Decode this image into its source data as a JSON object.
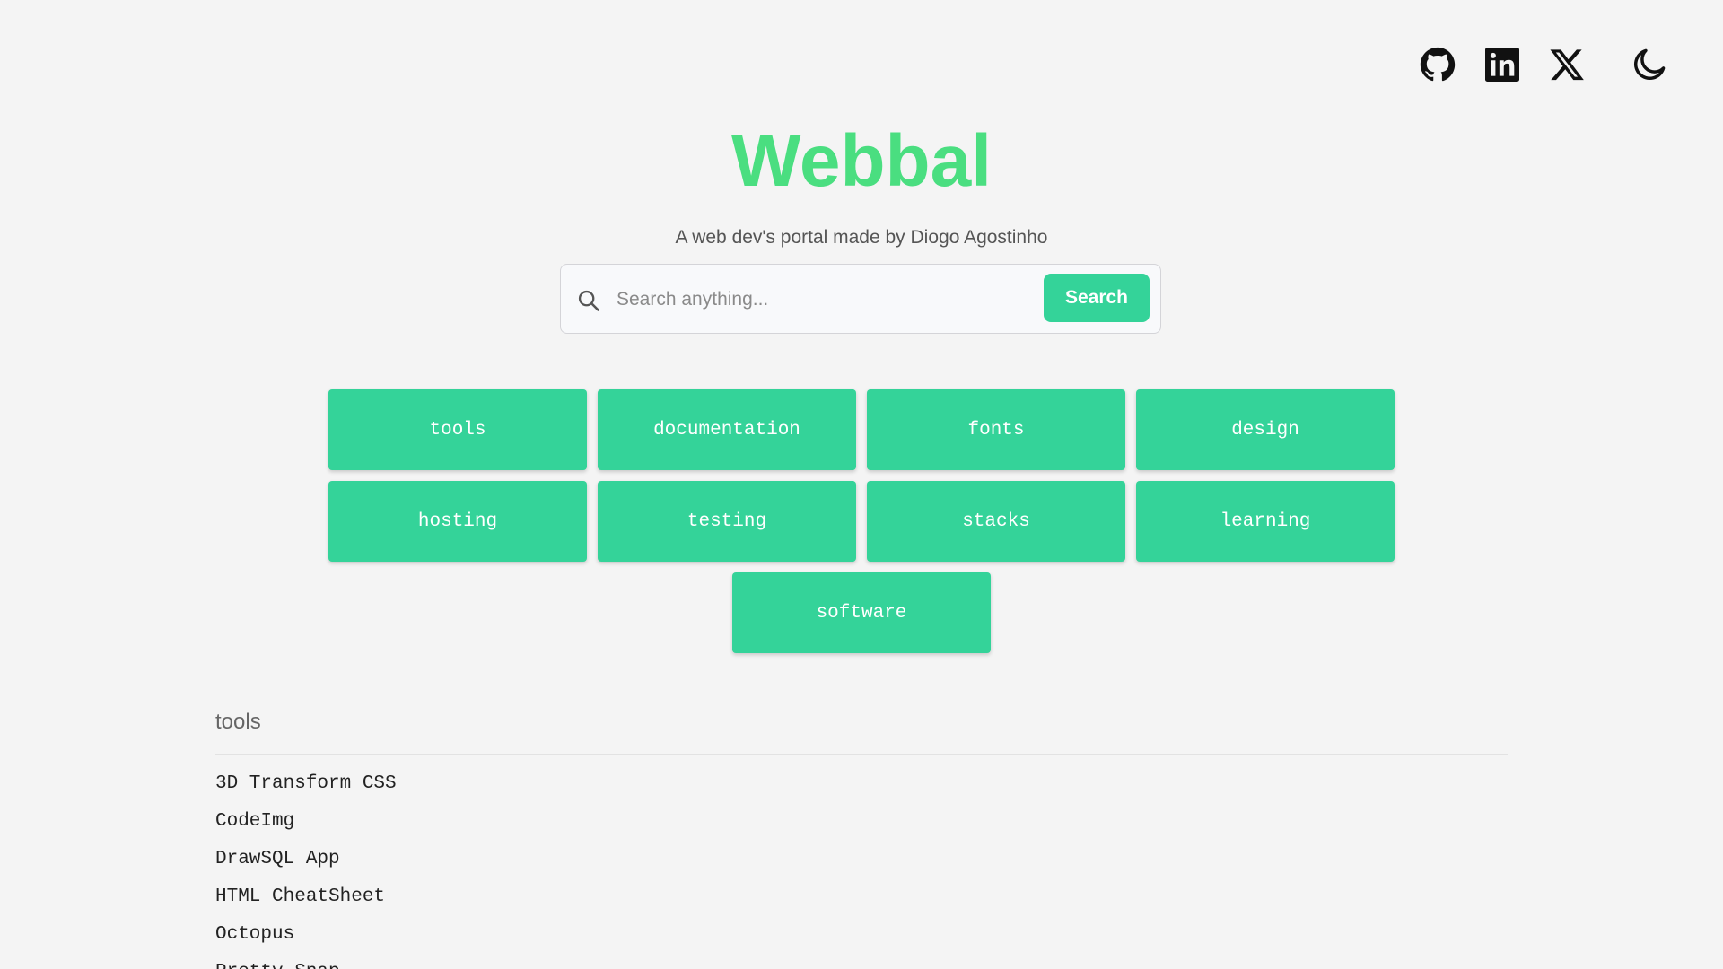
{
  "nav": {
    "icons": [
      "github-icon",
      "linkedin-icon",
      "x-icon",
      "moon-icon"
    ]
  },
  "hero": {
    "title": "Webbal",
    "subtitle": "A web dev's portal made by Diogo Agostinho"
  },
  "search": {
    "placeholder": "Search anything...",
    "button_label": "Search"
  },
  "categories": [
    "tools",
    "documentation",
    "fonts",
    "design",
    "hosting",
    "testing",
    "stacks",
    "learning",
    "software"
  ],
  "section": {
    "title": "tools",
    "items": [
      "3D Transform CSS",
      "CodeImg",
      "DrawSQL App",
      "HTML CheatSheet",
      "Octopus",
      "Pretty Snap"
    ]
  },
  "colors": {
    "accent": "#34d399",
    "title": "#4ade80",
    "background": "#f4f4f4"
  }
}
